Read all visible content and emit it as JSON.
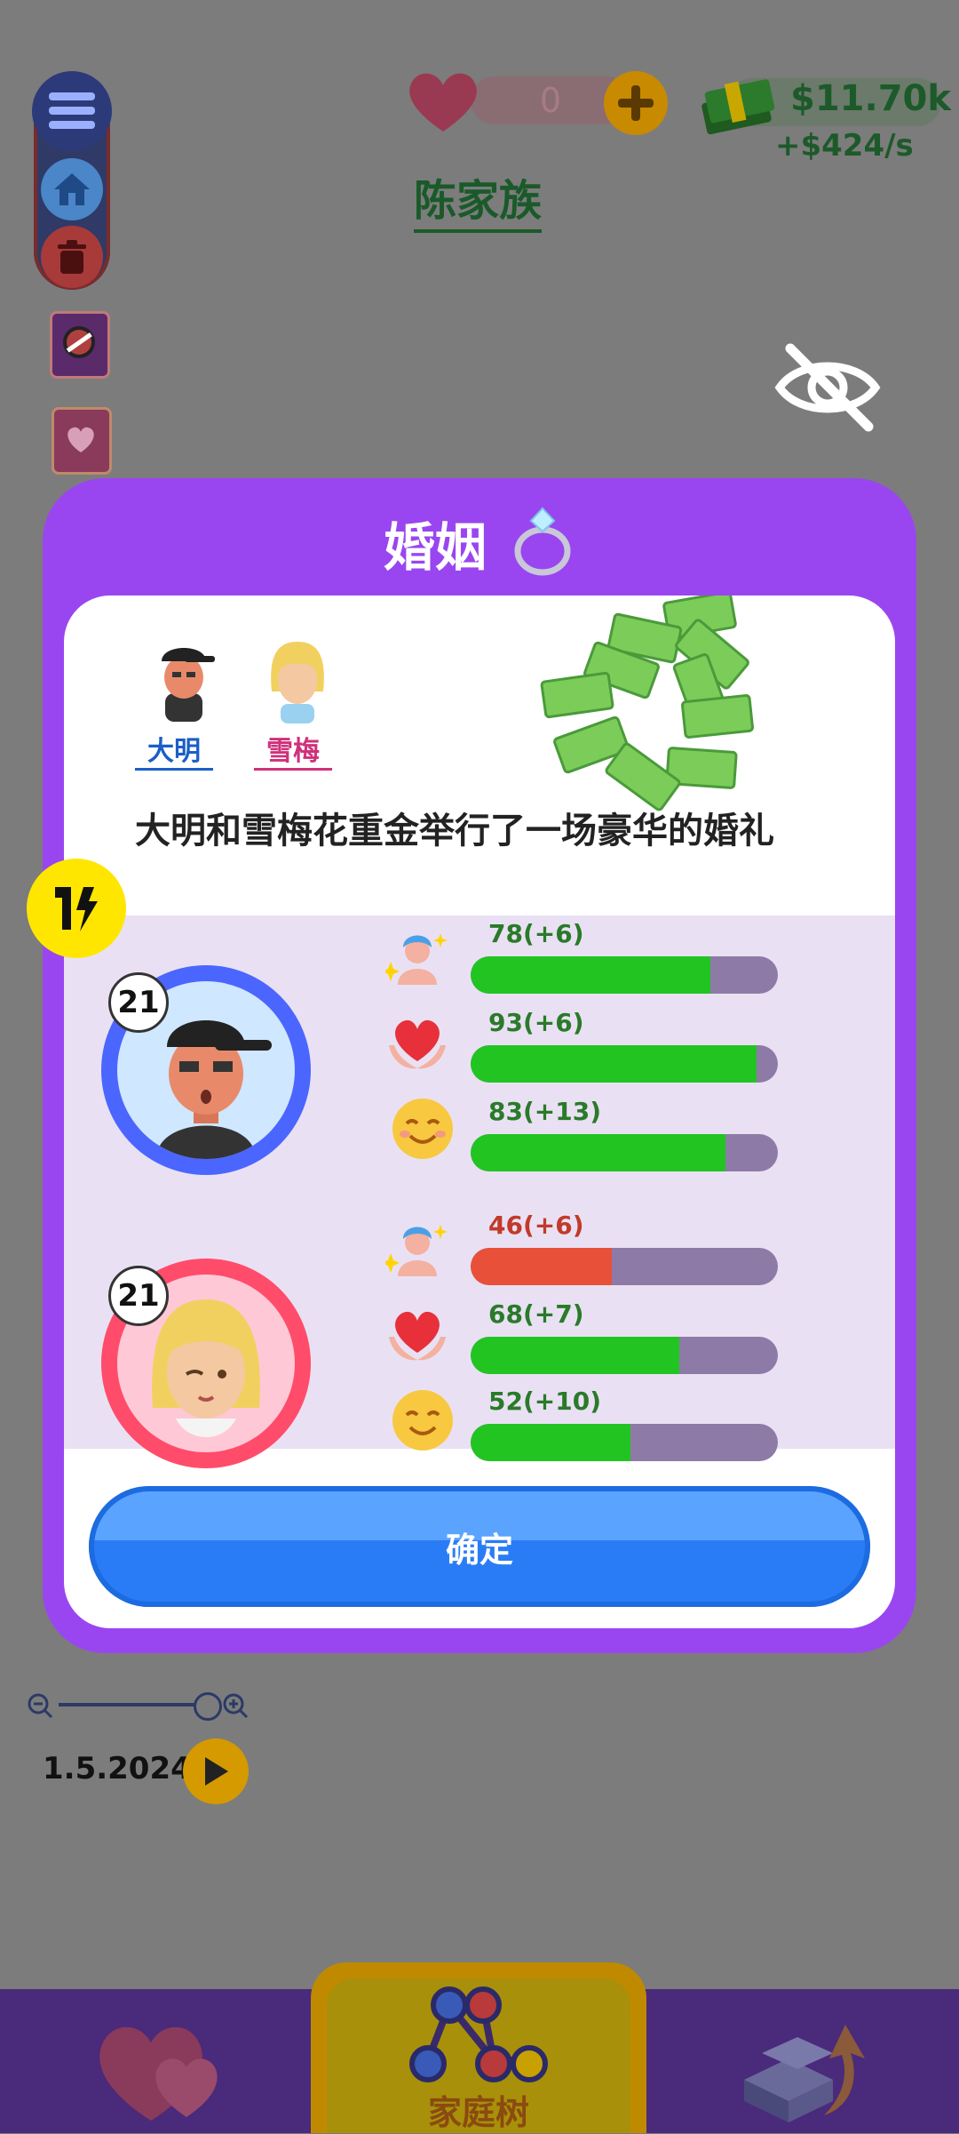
{
  "top_bar": {
    "hearts_count": "0",
    "money": "$11.70k",
    "money_rate": "+$424/s"
  },
  "family": {
    "name": "陈家族"
  },
  "modal": {
    "title": "婚姻",
    "groom_name": "大明",
    "bride_name": "雪梅",
    "description": "大明和雪梅花重金举行了一场豪华的婚礼",
    "confirm_label": "确定"
  },
  "groom": {
    "age": "21",
    "stats": [
      {
        "icon": "looks-icon",
        "label_value": "78",
        "label_delta": "(+6)",
        "value": 78,
        "color": "#22c422",
        "label_color": "#2a7a2a"
      },
      {
        "icon": "heart-hands-icon",
        "label_value": "93",
        "label_delta": "(+6)",
        "value": 93,
        "color": "#22c422",
        "label_color": "#2a7a2a"
      },
      {
        "icon": "smile-icon",
        "label_value": "83",
        "label_delta": "(+13)",
        "value": 83,
        "color": "#22c422",
        "label_color": "#2a7a2a"
      }
    ]
  },
  "bride": {
    "age": "21",
    "stats": [
      {
        "icon": "looks-icon",
        "label_value": "46",
        "label_delta": "(+6)",
        "value": 46,
        "color": "#e8503a",
        "label_color": "#c23a2a"
      },
      {
        "icon": "heart-hands-icon",
        "label_value": "68",
        "label_delta": "(+7)",
        "value": 68,
        "color": "#22c422",
        "label_color": "#2a7a2a"
      },
      {
        "icon": "smile-icon",
        "label_value": "52",
        "label_delta": "(+10)",
        "value": 52,
        "color": "#22c422",
        "label_color": "#2a7a2a"
      }
    ]
  },
  "timeline": {
    "date": "1.5.2024"
  },
  "bottom_nav": {
    "family_tree_label": "家庭树"
  },
  "colors": {
    "modal_purple": "#9a46f0",
    "groom_ring": "#4a66ff",
    "bride_ring": "#ff4c6a",
    "confirm_blue": "#2a7cf6"
  }
}
